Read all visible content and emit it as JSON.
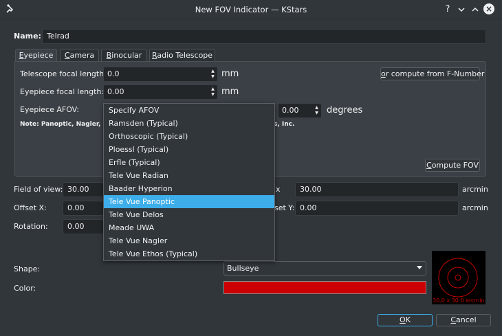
{
  "window": {
    "title": "New FOV Indicator — KStars",
    "help_glyph": "?",
    "minimize_glyph": "∨",
    "maximize_glyph": "∧",
    "close_glyph": "×"
  },
  "name": {
    "label": "Name:",
    "value": "Telrad"
  },
  "tabs": [
    {
      "label": "Eyepiece",
      "accel": "E",
      "rest": "yepiece"
    },
    {
      "label": "Camera",
      "pre": "",
      "accel": "C",
      "rest": "amera"
    },
    {
      "label": "Binocular",
      "accel": "B",
      "rest": "inocular"
    },
    {
      "label": "Radio Telescope",
      "accel": "R",
      "rest": "adio Telescope"
    }
  ],
  "eyepiece": {
    "telescope_fl_label": "Telescope focal length:",
    "telescope_fl_value": "0.0",
    "telescope_fl_unit": "mm",
    "eyepiece_fl_label": "Eyepiece focal length:",
    "eyepiece_fl_value": "0.00",
    "eyepiece_fl_unit": "mm",
    "afov_label": "Eyepiece AFOV:",
    "afov_value": "0.00",
    "afov_unit": "degrees",
    "note_left": "Note: Panoptic, Nagler, Ra",
    "note_right": "s, Inc.",
    "compute_fnumber_button": {
      "accel": "o",
      "rest": "r compute from F-Number"
    },
    "compute_fov_button": {
      "accel": "C",
      "rest": "ompute FOV"
    }
  },
  "afov_dropdown": {
    "options": [
      "Specify AFOV",
      "Ramsden (Typical)",
      "Orthoscopic (Typical)",
      "Ploessl (Typical)",
      "Erfle (Typical)",
      "Tele Vue Radian",
      "Baader Hyperion",
      "Tele Vue Panoptic",
      "Tele Vue Delos",
      "Meade UWA",
      "Tele Vue Nagler",
      "Tele Vue Ethos (Typical)"
    ],
    "selected": "Tele Vue Panoptic"
  },
  "fov": {
    "fov_label": "Field of view:",
    "fov_value": "30.00",
    "fov_y_label_partial": "x",
    "fov_y_value": "30.00",
    "fov_y_unit": "arcmin",
    "offset_x_label": "Offset X:",
    "offset_x_value": "0.00",
    "offset_y_label_partial": "set Y:",
    "offset_y_value": "0.00",
    "offset_y_unit": "arcmin",
    "rotation_label": "Rotation:",
    "rotation_value": "0.00"
  },
  "shape": {
    "label": "Shape:",
    "value": "Bullseye"
  },
  "color": {
    "label": "Color:",
    "swatch": "#cc0000"
  },
  "preview": {
    "caption": "30.0 x 30.0 arcmin",
    "color": "#cc0000"
  },
  "buttons": {
    "ok": {
      "accel": "O",
      "rest": "K"
    },
    "cancel": {
      "accel": "C",
      "rest": "ancel"
    }
  },
  "colors": {
    "accent": "#3daee9",
    "background": "#31363b",
    "field": "#232629"
  }
}
